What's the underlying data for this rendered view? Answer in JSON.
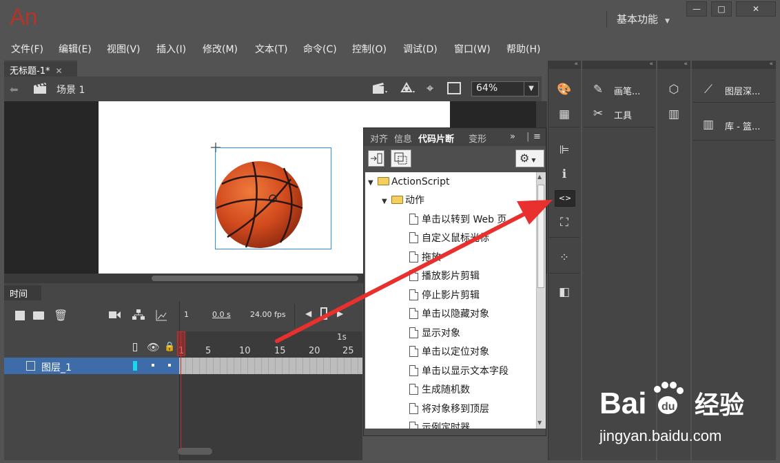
{
  "app": {
    "logo": "An",
    "workspace": "基本功能"
  },
  "window_controls": {
    "minimize": "—",
    "maximize": "□",
    "close": "✕"
  },
  "menu": [
    "文件(F)",
    "编辑(E)",
    "视图(V)",
    "插入(I)",
    "修改(M)",
    "文本(T)",
    "命令(C)",
    "控制(O)",
    "调试(D)",
    "窗口(W)",
    "帮助(H)"
  ],
  "document": {
    "tab_title": "无标题-1*",
    "scene": "场景 1",
    "zoom": "64%"
  },
  "timeline": {
    "tab": "时间轴",
    "current_frame": "1",
    "elapsed": "0.0 s",
    "fps": "24.00 fps",
    "ruler_seconds": "1s",
    "ruler_marks": [
      "1",
      "5",
      "10",
      "15",
      "20",
      "25"
    ],
    "layers": [
      {
        "name": "图层_1"
      }
    ]
  },
  "snippets_panel": {
    "tabs": [
      "对齐",
      "信息",
      "代码片断",
      "变形"
    ],
    "active_tab": "代码片断",
    "tree": {
      "root": "ActionScript",
      "folder": "动作",
      "items": [
        "单击以转到 Web 页",
        "自定义鼠标光标",
        "拖放",
        "播放影片剪辑",
        "停止影片剪辑",
        "单击以隐藏对象",
        "显示对象",
        "单击以定位对象",
        "单击以显示文本字段",
        "生成随机数",
        "将对象移到顶层",
        "示例定时器"
      ]
    }
  },
  "right_dock": {
    "panel_labels": [
      "画笔...",
      "工具",
      "图层深...",
      "库 - 篮..."
    ],
    "collapse_glyph": "«"
  },
  "watermark": {
    "brand": "Bai",
    "brand_suffix": "经验",
    "url": "jingyan.baidu.com"
  },
  "colors": {
    "annotation_arrow": "#e8312f",
    "selection": "#3d6ca8",
    "logo": "#b0362a"
  }
}
